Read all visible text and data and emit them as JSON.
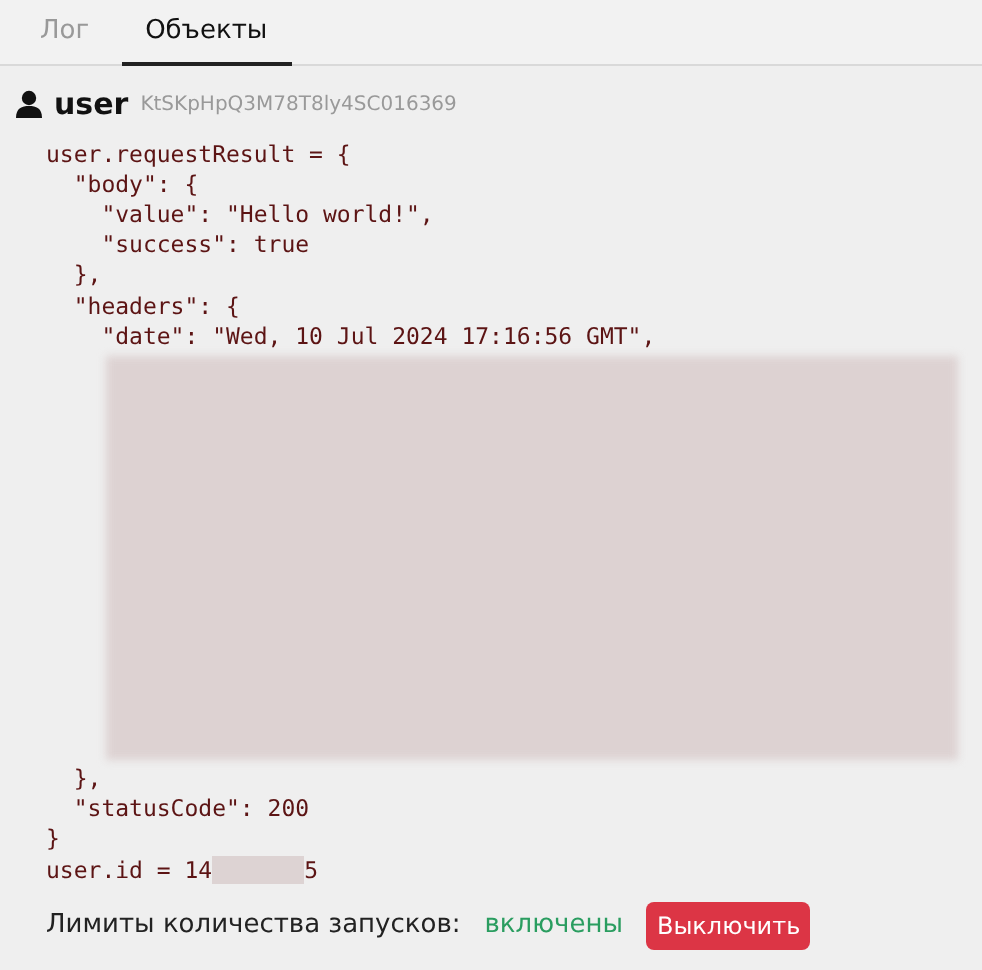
{
  "tabs": [
    {
      "label": "Лог",
      "selected": false
    },
    {
      "label": "Объекты",
      "selected": true
    }
  ],
  "object": {
    "name": "user",
    "id": "KtSKpHpQ3M78T8ly4SC016369"
  },
  "code": [
    {
      "kind": "line",
      "text": "user.requestResult = {"
    },
    {
      "kind": "line",
      "text": "  \"body\": {"
    },
    {
      "kind": "line",
      "text": "    \"value\": \"Hello world!\","
    },
    {
      "kind": "line",
      "text": "    \"success\": true"
    },
    {
      "kind": "line",
      "text": "  },"
    },
    {
      "kind": "line",
      "text": "  \"headers\": {"
    },
    {
      "kind": "line",
      "text": "    \"date\": \"Wed, 10 Jul 2024 17:16:56 GMT\","
    },
    {
      "kind": "redacted"
    },
    {
      "kind": "line",
      "text": "  },"
    },
    {
      "kind": "line",
      "text": "  \"statusCode\": 200"
    },
    {
      "kind": "line",
      "text": "}"
    }
  ],
  "user_id": {
    "prefix": "user.id = 14",
    "suffix": "5"
  },
  "limits": {
    "label": "Лимиты количества запусков:",
    "status": "включены",
    "button": "Выключить"
  }
}
